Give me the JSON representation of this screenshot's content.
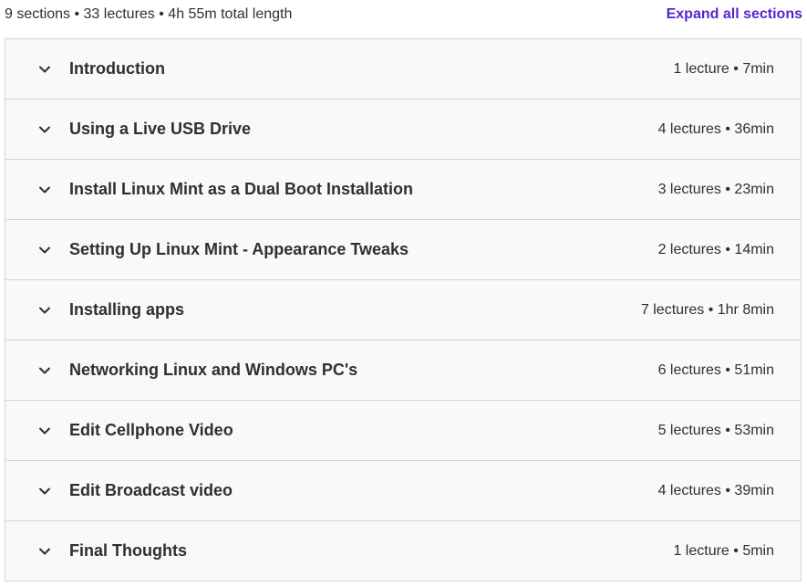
{
  "summary": "9 sections • 33 lectures • 4h 55m total length",
  "expand_all_label": "Expand all sections",
  "sections": [
    {
      "title": "Introduction",
      "meta": "1 lecture • 7min"
    },
    {
      "title": "Using a Live USB Drive",
      "meta": "4 lectures • 36min"
    },
    {
      "title": "Install Linux Mint as a Dual Boot Installation",
      "meta": "3 lectures • 23min"
    },
    {
      "title": "Setting Up Linux Mint - Appearance Tweaks",
      "meta": "2 lectures • 14min"
    },
    {
      "title": "Installing apps",
      "meta": "7 lectures • 1hr 8min"
    },
    {
      "title": "Networking Linux and Windows PC's",
      "meta": "6 lectures • 51min"
    },
    {
      "title": "Edit Cellphone Video",
      "meta": "5 lectures • 53min"
    },
    {
      "title": "Edit Broadcast video",
      "meta": "4 lectures • 39min"
    },
    {
      "title": "Final Thoughts",
      "meta": "1 lecture • 5min"
    }
  ],
  "icons": {
    "section_toggle": "chevron-down-icon"
  },
  "colors": {
    "accent": "#5624d0",
    "section_bg": "#f7f9fa",
    "border": "#d1d7dc",
    "text": "#2d2f31"
  }
}
